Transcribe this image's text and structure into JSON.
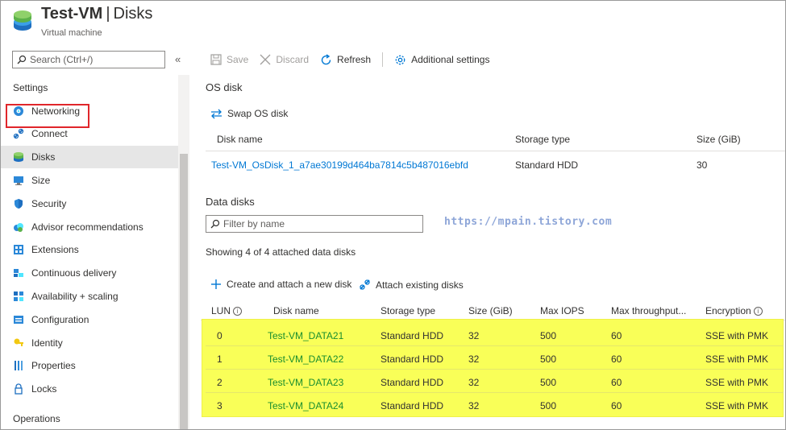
{
  "header": {
    "resource_name": "Test-VM",
    "separator": "|",
    "page_title": "Disks",
    "subtitle": "Virtual machine"
  },
  "sidebar": {
    "search_placeholder": "Search (Ctrl+/)",
    "collapse_glyph": "«",
    "settings_label": "Settings",
    "operations_label": "Operations",
    "items": [
      {
        "label": "Networking",
        "icon": "networking-icon"
      },
      {
        "label": "Connect",
        "icon": "connect-icon"
      },
      {
        "label": "Disks",
        "icon": "disks-icon",
        "selected": true
      },
      {
        "label": "Size",
        "icon": "size-icon"
      },
      {
        "label": "Security",
        "icon": "security-icon"
      },
      {
        "label": "Advisor recommendations",
        "icon": "advisor-icon"
      },
      {
        "label": "Extensions",
        "icon": "extensions-icon"
      },
      {
        "label": "Continuous delivery",
        "icon": "continuous-delivery-icon"
      },
      {
        "label": "Availability + scaling",
        "icon": "availability-icon"
      },
      {
        "label": "Configuration",
        "icon": "configuration-icon"
      },
      {
        "label": "Identity",
        "icon": "identity-icon"
      },
      {
        "label": "Properties",
        "icon": "properties-icon"
      },
      {
        "label": "Locks",
        "icon": "locks-icon"
      }
    ]
  },
  "toolbar": {
    "save": "Save",
    "discard": "Discard",
    "refresh": "Refresh",
    "additional_settings": "Additional settings"
  },
  "os_disk": {
    "heading": "OS disk",
    "swap_label": "Swap OS disk",
    "columns": [
      "Disk name",
      "Storage type",
      "Size (GiB)"
    ],
    "row": {
      "disk_name": "Test-VM_OsDisk_1_a7ae30199d464ba7814c5b487016ebfd",
      "storage_type": "Standard HDD",
      "size": "30"
    }
  },
  "data_disks": {
    "heading": "Data disks",
    "filter_placeholder": "Filter by name",
    "showing_text": "Showing 4 of 4 attached data disks",
    "create_label": "Create and attach a new disk",
    "attach_label": "Attach existing disks",
    "columns": {
      "lun": "LUN",
      "disk_name": "Disk name",
      "storage_type": "Storage type",
      "size": "Size (GiB)",
      "max_iops": "Max IOPS",
      "max_throughput": "Max throughput...",
      "encryption": "Encryption"
    },
    "rows": [
      {
        "lun": "0",
        "disk_name": "Test-VM_DATA21",
        "storage_type": "Standard HDD",
        "size": "32",
        "max_iops": "500",
        "max_throughput": "60",
        "encryption": "SSE with PMK"
      },
      {
        "lun": "1",
        "disk_name": "Test-VM_DATA22",
        "storage_type": "Standard HDD",
        "size": "32",
        "max_iops": "500",
        "max_throughput": "60",
        "encryption": "SSE with PMK"
      },
      {
        "lun": "2",
        "disk_name": "Test-VM_DATA23",
        "storage_type": "Standard HDD",
        "size": "32",
        "max_iops": "500",
        "max_throughput": "60",
        "encryption": "SSE with PMK"
      },
      {
        "lun": "3",
        "disk_name": "Test-VM_DATA24",
        "storage_type": "Standard HDD",
        "size": "32",
        "max_iops": "500",
        "max_throughput": "60",
        "encryption": "SSE with PMK"
      }
    ]
  },
  "watermark": "https://mpain.tistory.com",
  "colors": {
    "link": "#0078d4",
    "highlight": "#f9ff58",
    "selection_outline": "#e0262b",
    "row_link": "#1a8e2e"
  }
}
